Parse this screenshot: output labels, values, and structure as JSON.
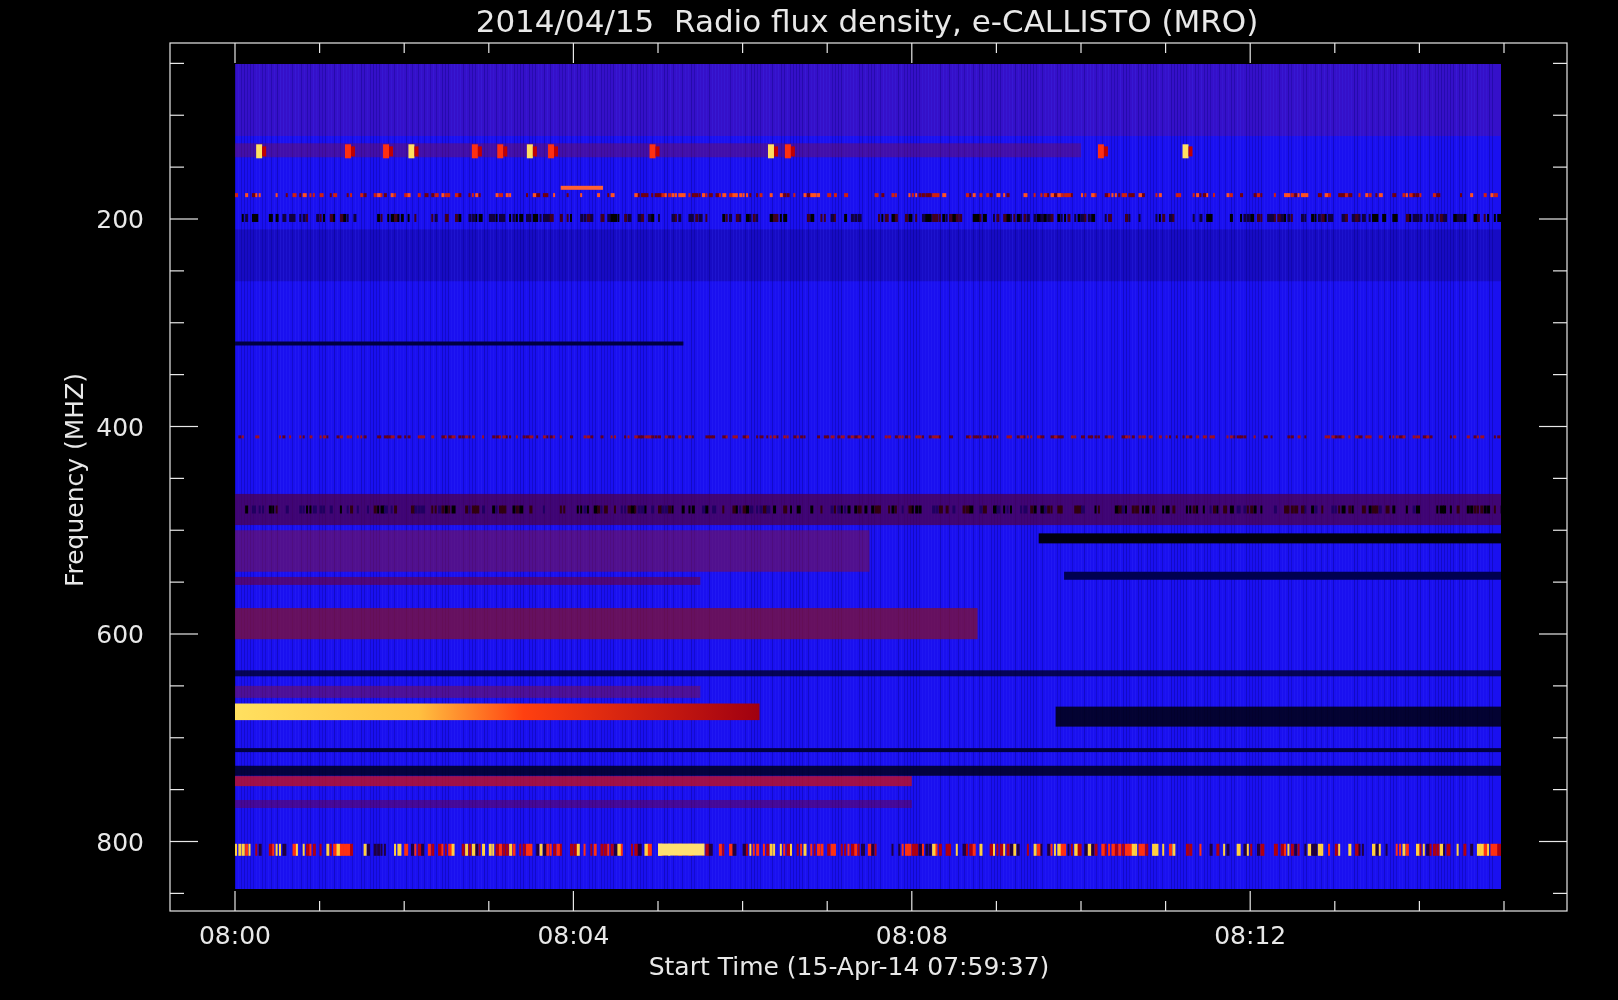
{
  "plot": {
    "title": "2014/04/15  Radio flux density, e-CALLISTO (MRO)",
    "ylabel": "Frequency (MHZ)",
    "xlabel": "Start Time (15-Apr-14 07:59:37)",
    "yticks": [
      "200",
      "400",
      "600",
      "800"
    ],
    "xticks": [
      "08:00",
      "08:04",
      "08:08",
      "08:12"
    ]
  }
}
